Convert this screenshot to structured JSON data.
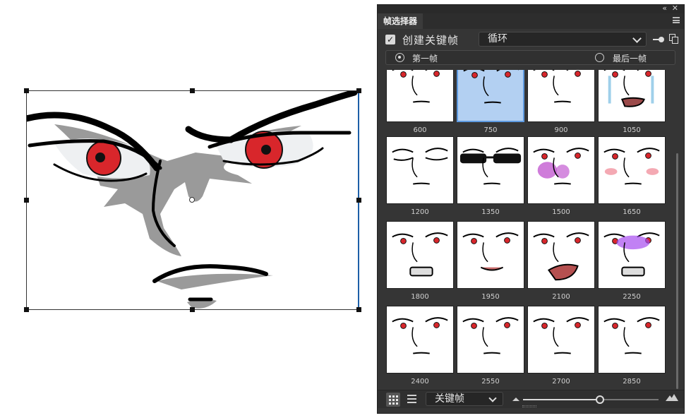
{
  "panel": {
    "title": "帧选择器",
    "create_keyframe_label": "创建关键帧",
    "create_keyframe_checked": true,
    "loop_mode": "循环",
    "first_frame_label": "第一帧",
    "last_frame_label": "最后一帧",
    "selected_start": "first_frame",
    "frames": [
      {
        "number": "600"
      },
      {
        "number": "750",
        "selected": true
      },
      {
        "number": "900"
      },
      {
        "number": "1050"
      },
      {
        "number": "1200"
      },
      {
        "number": "1350"
      },
      {
        "number": "1500"
      },
      {
        "number": "1650"
      },
      {
        "number": "1800"
      },
      {
        "number": "1950"
      },
      {
        "number": "2100"
      },
      {
        "number": "2250"
      },
      {
        "number": "2400"
      },
      {
        "number": "2550"
      },
      {
        "number": "2700"
      },
      {
        "number": "2850"
      }
    ],
    "filter_value": "关键帧",
    "thumbnail_size_fraction": 0.57,
    "selection_color": "#b3d0f2",
    "icons": [
      "collapse-icon",
      "close-icon",
      "panel-menu-icon",
      "pin-icon",
      "copy-icon",
      "grid-view-icon",
      "list-view-icon",
      "small-thumbnail-icon",
      "large-thumbnail-icon"
    ]
  },
  "canvas": {
    "selection_color": "#1d5fa8",
    "eye_color": "#d8262b"
  }
}
